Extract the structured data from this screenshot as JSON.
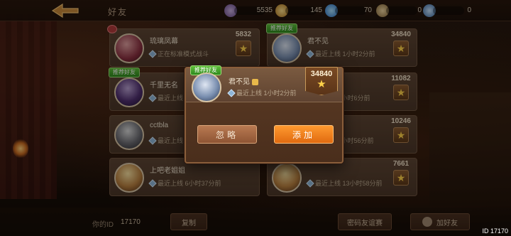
{
  "header": {
    "title": "好友",
    "resources": [
      {
        "icon": "feather-icon",
        "value": "5535"
      },
      {
        "icon": "coin-icon",
        "value": "145"
      },
      {
        "icon": "diamond-icon",
        "value": "70"
      },
      {
        "icon": "key-gold-icon",
        "value": "0"
      },
      {
        "icon": "key-blue-icon",
        "value": "0"
      }
    ]
  },
  "friends": [
    {
      "name": "琉璃凤幕",
      "status": "正在标准模式战斗",
      "score": "5832",
      "tag": ""
    },
    {
      "name": "君不见",
      "status": "最近上线 1小时2分前",
      "score": "34840",
      "tag": "推荐好友"
    },
    {
      "name": "千里无名",
      "status": "最近上线",
      "score": "",
      "tag": "推荐好友"
    },
    {
      "name": "",
      "status": "...小时6分前",
      "score": "11082",
      "tag": ""
    },
    {
      "name": "cctbla",
      "status": "最近上线",
      "score": "",
      "tag": ""
    },
    {
      "name": "",
      "status": "...小时56分前",
      "score": "10246",
      "tag": ""
    },
    {
      "name": "上吧老姐姐",
      "status": "最近上线 6小时37分前",
      "score": "",
      "tag": ""
    },
    {
      "name": "",
      "status": "最近上线 13小时58分前",
      "score": "7661",
      "tag": ""
    }
  ],
  "popup": {
    "tag": "推荐好友",
    "name": "君不见",
    "status": "最近上线 1小时2分前",
    "score": "34840",
    "ignore_label": "忽略",
    "add_label": "添加"
  },
  "footer": {
    "my_id_label": "你的ID",
    "my_id_value": "17170",
    "copy_label": "复制",
    "invite_label": "密码友谊赛",
    "add_friend_label": "加好友",
    "corner_id": "ID 17170"
  },
  "colors": {
    "accent_orange": "#ff9a30",
    "recommend_green": "#5fbf3a",
    "star_gold": "#ffd24a"
  }
}
